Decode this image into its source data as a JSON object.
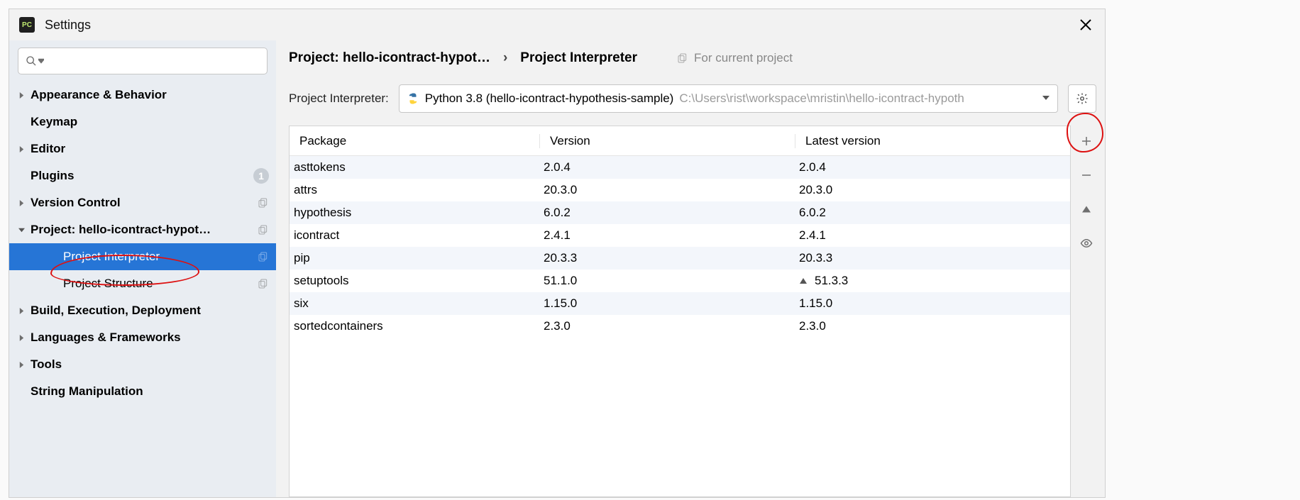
{
  "window": {
    "title": "Settings",
    "app_icon_text": "PC"
  },
  "sidebar": {
    "search_placeholder": "",
    "items": [
      {
        "label": "Appearance & Behavior",
        "expandable": true
      },
      {
        "label": "Keymap"
      },
      {
        "label": "Editor",
        "expandable": true
      },
      {
        "label": "Plugins",
        "badge": "1"
      },
      {
        "label": "Version Control",
        "expandable": true,
        "hasCopy": true
      },
      {
        "label": "Project: hello-icontract-hypot…",
        "expandable": true,
        "expanded": true,
        "hasCopy": true
      },
      {
        "label": "Project Interpreter",
        "level": 1,
        "selected": true,
        "hasCopy": true
      },
      {
        "label": "Project Structure",
        "level": 1,
        "hasCopy": true
      },
      {
        "label": "Build, Execution, Deployment",
        "expandable": true
      },
      {
        "label": "Languages & Frameworks",
        "expandable": true
      },
      {
        "label": "Tools",
        "expandable": true
      },
      {
        "label": "String Manipulation"
      }
    ]
  },
  "breadcrumb": {
    "project": "Project: hello-icontract-hypot…",
    "page": "Project Interpreter",
    "scope": "For current project"
  },
  "interpreter": {
    "label": "Project Interpreter:",
    "name": "Python 3.8 (hello-icontract-hypothesis-sample)",
    "path": "C:\\Users\\rist\\workspace\\mristin\\hello-icontract-hypoth"
  },
  "packages": {
    "columns": {
      "pkg": "Package",
      "ver": "Version",
      "lat": "Latest version"
    },
    "rows": [
      {
        "pkg": "asttokens",
        "ver": "2.0.4",
        "lat": "2.0.4"
      },
      {
        "pkg": "attrs",
        "ver": "20.3.0",
        "lat": "20.3.0"
      },
      {
        "pkg": "hypothesis",
        "ver": "6.0.2",
        "lat": "6.0.2"
      },
      {
        "pkg": "icontract",
        "ver": "2.4.1",
        "lat": "2.4.1"
      },
      {
        "pkg": "pip",
        "ver": "20.3.3",
        "lat": "20.3.3"
      },
      {
        "pkg": "setuptools",
        "ver": "51.1.0",
        "lat": "51.3.3",
        "update": true
      },
      {
        "pkg": "six",
        "ver": "1.15.0",
        "lat": "1.15.0"
      },
      {
        "pkg": "sortedcontainers",
        "ver": "2.3.0",
        "lat": "2.3.0"
      }
    ]
  }
}
